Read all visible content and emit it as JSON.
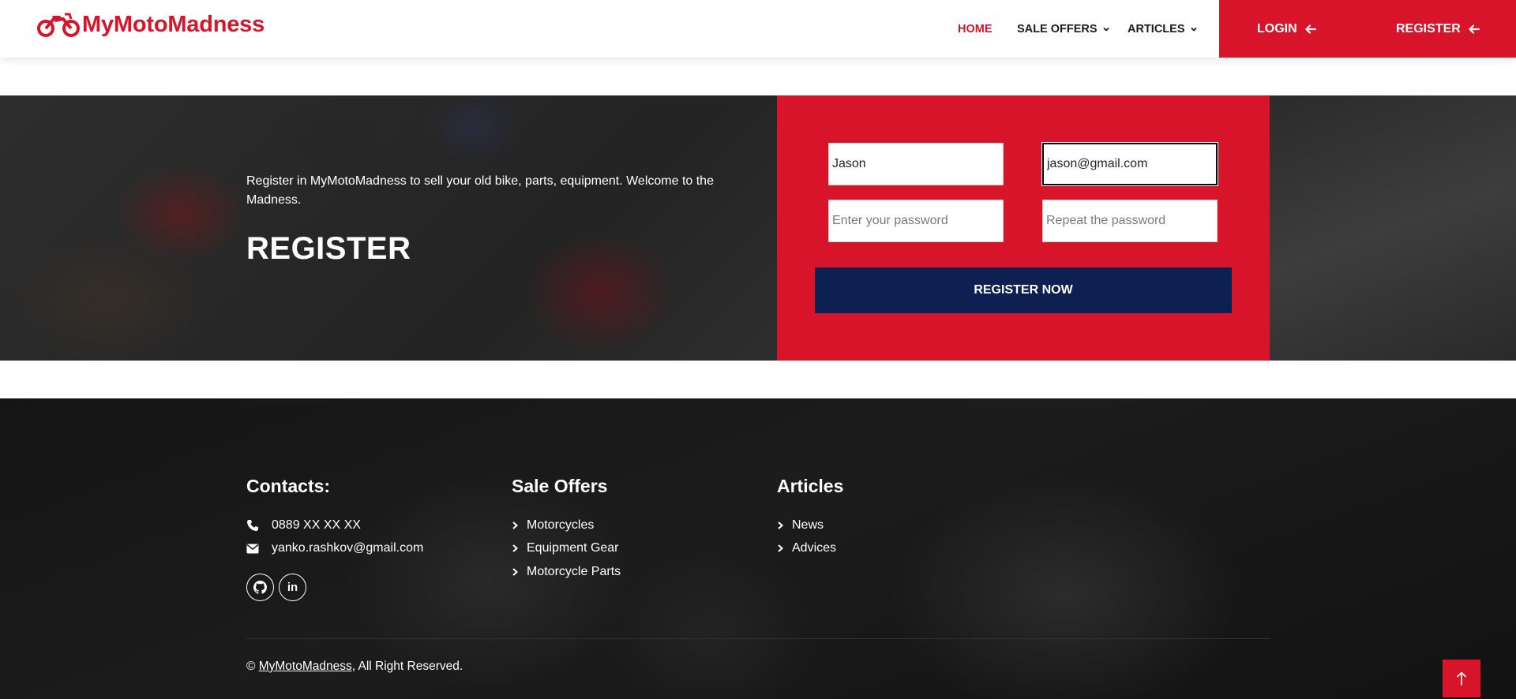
{
  "brand": {
    "name": "MyMotoMadness",
    "accent": "#d7142a",
    "navy": "#0e1f52"
  },
  "nav": {
    "home": "HOME",
    "sale_offers": "SALE OFFERS",
    "articles": "ARTICLES",
    "login": "LOGIN",
    "register": "REGISTER"
  },
  "hero": {
    "subtitle": "Register in MyMotoMadness to sell your old bike, parts, equipment. Welcome to the Madness.",
    "title": "REGISTER"
  },
  "form": {
    "name_value": "Jason",
    "email_value": "jason@gmail.com",
    "password_placeholder": "Enter your password",
    "repeat_placeholder": "Repeat the password",
    "submit_label": "REGISTER NOW"
  },
  "footer": {
    "contacts": {
      "heading": "Contacts:",
      "phone": "0889 XX XX XX",
      "email": "yanko.rashkov@gmail.com",
      "socials": [
        {
          "icon": "github-icon",
          "glyph": ""
        },
        {
          "icon": "linkedin-icon",
          "glyph": "in"
        }
      ]
    },
    "sale_offers": {
      "heading": "Sale Offers",
      "links": [
        "Motorcycles",
        "Equipment Gear",
        "Motorcycle Parts"
      ]
    },
    "articles": {
      "heading": "Articles",
      "links": [
        "News",
        "Advices"
      ]
    },
    "copyright": {
      "prefix": "©",
      "link_text": "MyMotoMadness",
      "suffix": ", All Right Reserved."
    }
  }
}
